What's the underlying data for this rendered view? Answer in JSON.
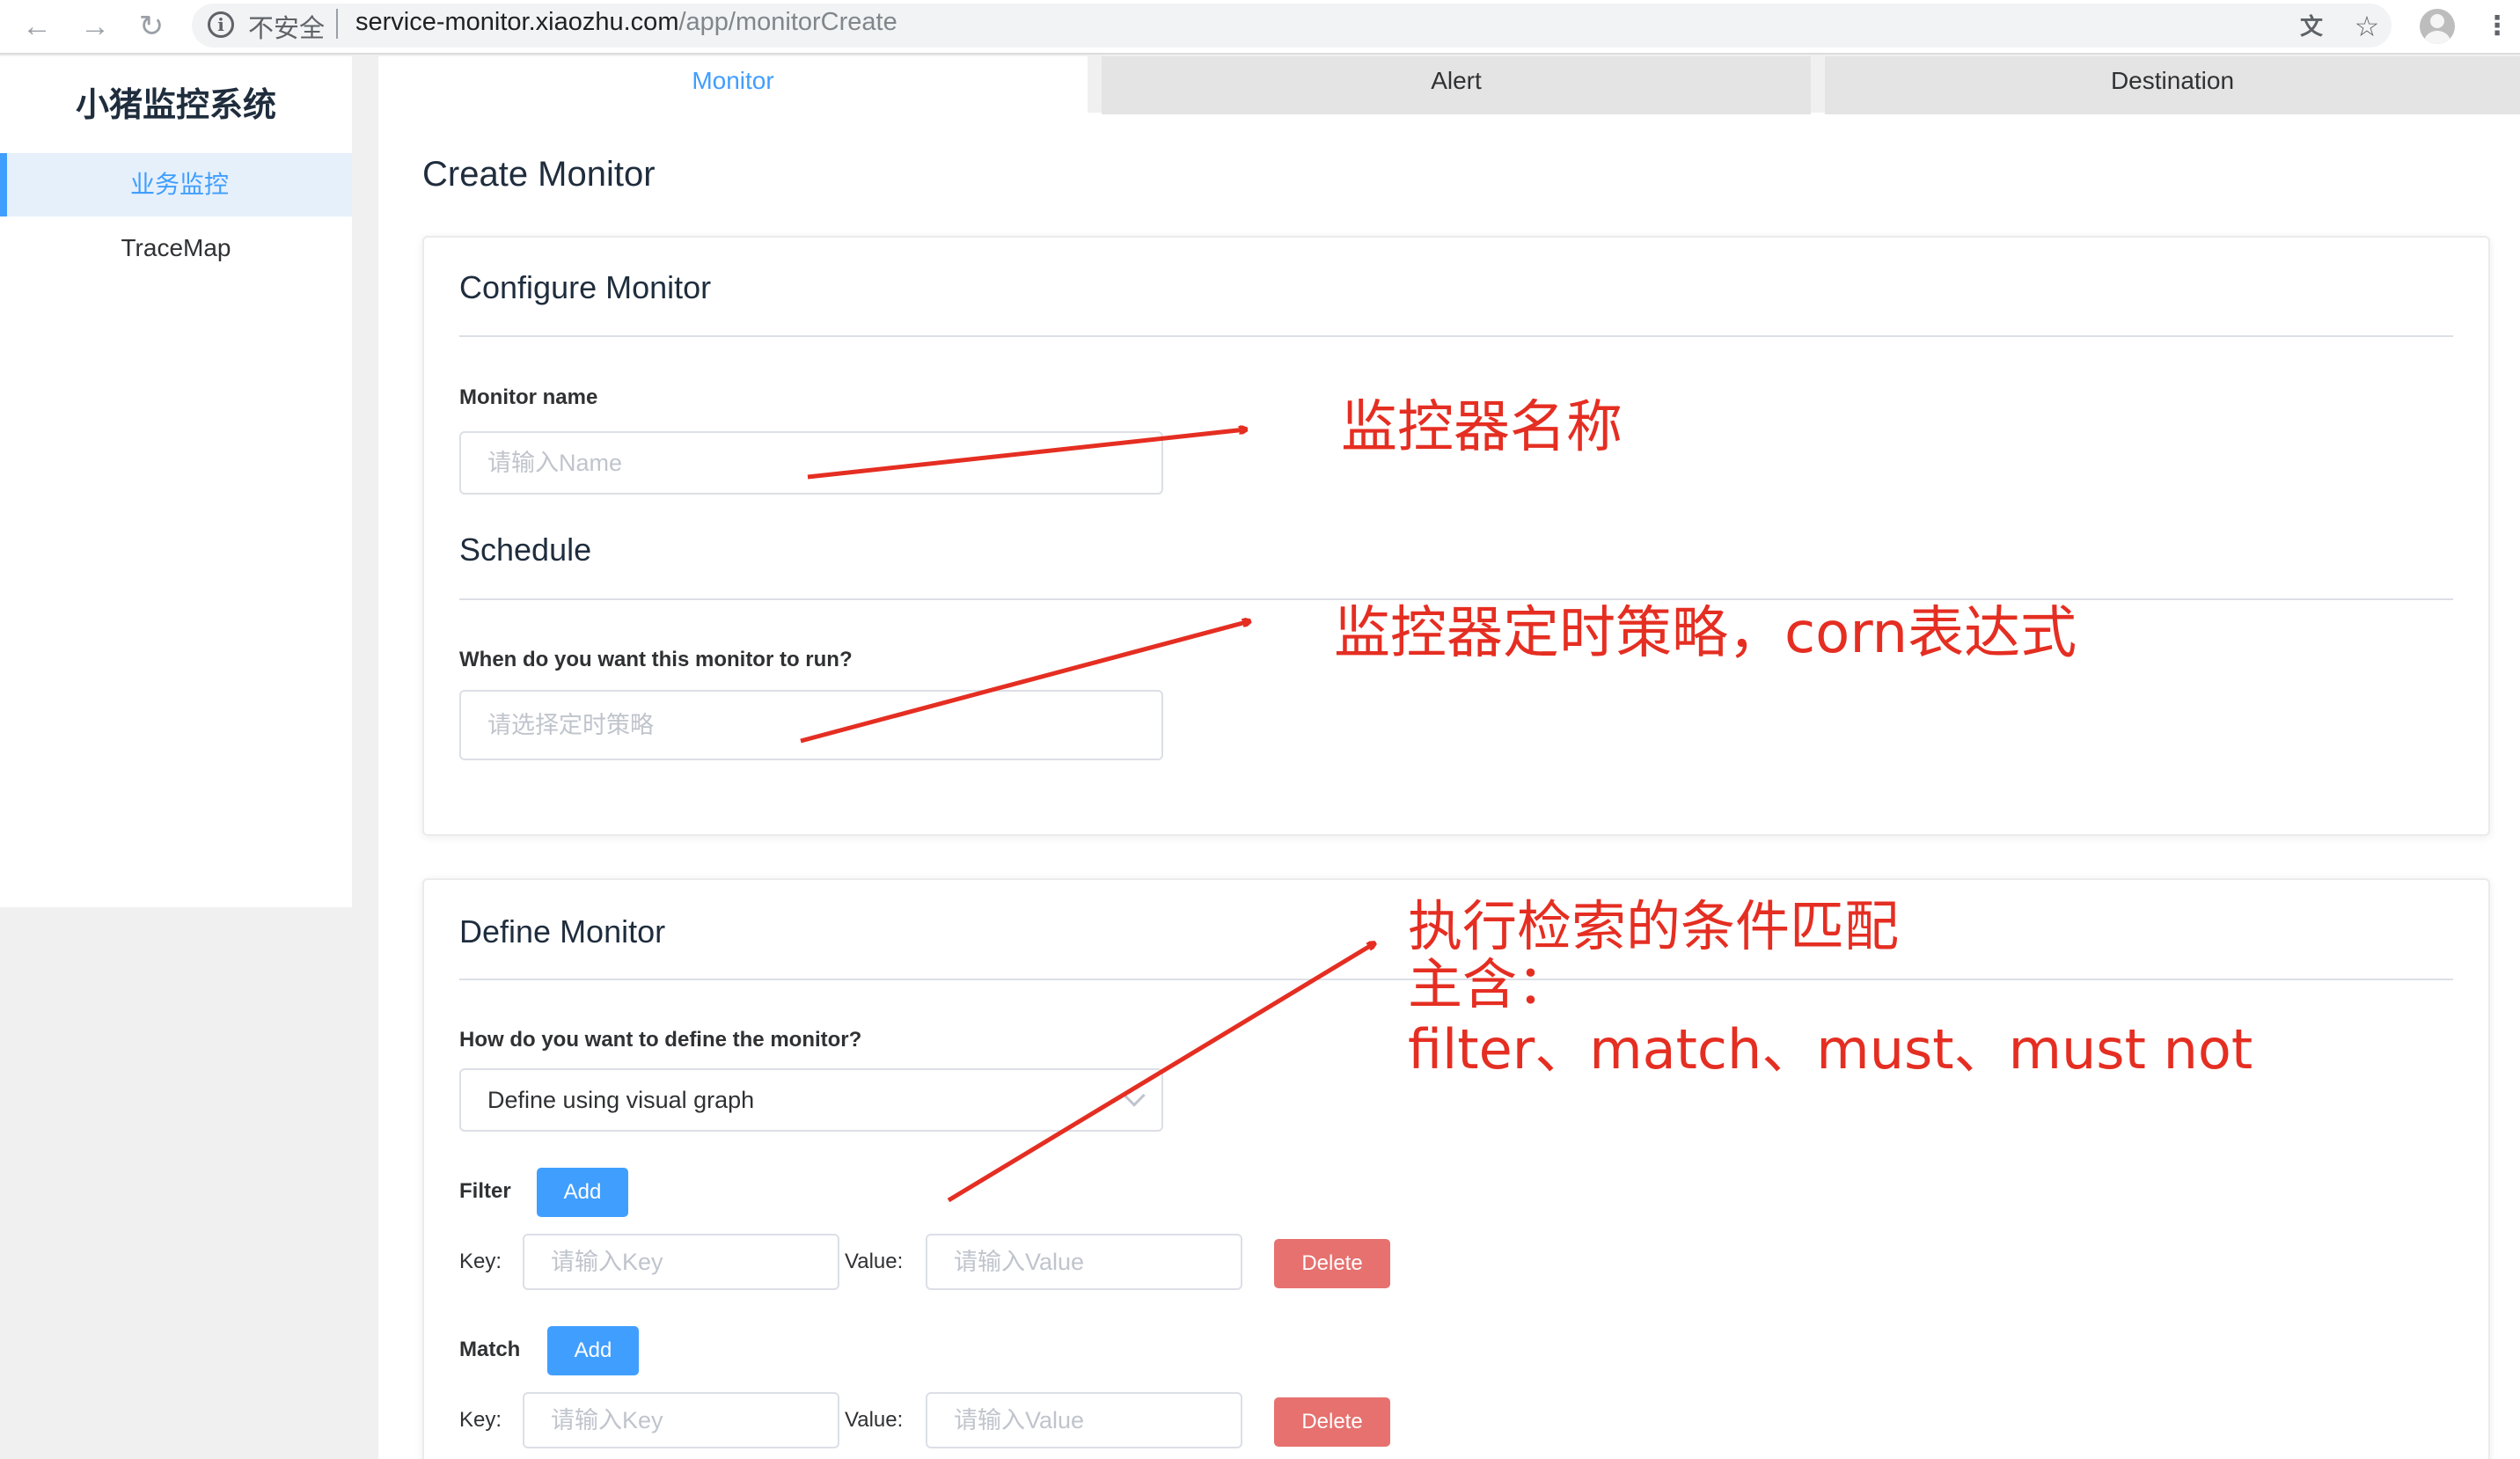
{
  "browser": {
    "insecure_label": "不安全",
    "url_domain": "service-monitor.xiaozhu.com",
    "url_path": "/app/monitorCreate",
    "icons": [
      "back-icon",
      "forward-icon",
      "reload-icon",
      "info-icon",
      "translate-icon",
      "star-icon",
      "avatar-icon",
      "more-icon"
    ]
  },
  "sidebar": {
    "title": "小猪监控系统",
    "items": [
      {
        "label": "业务监控",
        "active": true
      },
      {
        "label": "TraceMap",
        "active": false
      }
    ]
  },
  "tabs": [
    {
      "label": "Monitor",
      "active": true
    },
    {
      "label": "Alert",
      "active": false
    },
    {
      "label": "Destination",
      "active": false
    }
  ],
  "page_title": "Create Monitor",
  "configure": {
    "title": "Configure Monitor",
    "name_label": "Monitor name",
    "name_placeholder": "请输入Name",
    "schedule_title": "Schedule",
    "schedule_label": "When do you want this monitor to run?",
    "schedule_placeholder": "请选择定时策略"
  },
  "define": {
    "title": "Define Monitor",
    "method_label": "How do you want to define the monitor?",
    "method_value": "Define using visual graph",
    "filter": {
      "label": "Filter",
      "add": "Add",
      "key_label": "Key:",
      "key_placeholder": "请输入Key",
      "value_label": "Value:",
      "value_placeholder": "请输入Value",
      "delete": "Delete"
    },
    "match": {
      "label": "Match",
      "add": "Add",
      "key_label": "Key:",
      "key_placeholder": "请输入Key",
      "value_label": "Value:",
      "value_placeholder": "请输入Value",
      "delete": "Delete"
    }
  },
  "annotations": {
    "a1": "监控器名称",
    "a2": "监控器定时策略，corn表达式",
    "a3_line1": "执行检索的条件匹配",
    "a3_line2": "主含：",
    "a3_line3": "filter、match、must、must not",
    "color": "#e52e22"
  },
  "colors": {
    "primary": "#409eff",
    "danger": "#e6716f",
    "annotation": "#e52e22"
  }
}
